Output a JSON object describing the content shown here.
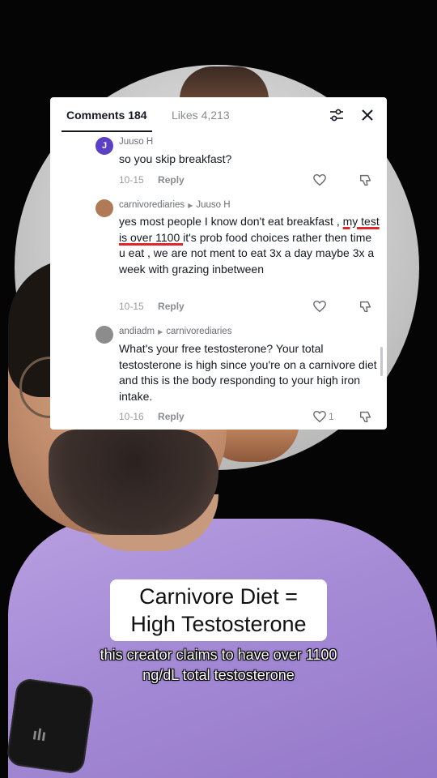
{
  "panel": {
    "tabs": [
      {
        "label": "Comments 184",
        "active": true
      },
      {
        "label": "Likes 4,213",
        "active": false
      }
    ],
    "filter_icon": "filter-sliders-icon",
    "close_icon": "close-icon"
  },
  "comments": [
    {
      "avatar_letter": "J",
      "avatar_color": "#5b3fc4",
      "author": "Juuso H",
      "reply_to": "",
      "text": "so you skip breakfast?",
      "date": "10-15",
      "reply_label": "Reply",
      "like_count": ""
    },
    {
      "avatar_letter": "",
      "avatar_color": "#b07a56",
      "author": "carnivorediaries",
      "reply_to": "Juuso H",
      "text_before": "yes most people I know don't eat breakfast , ",
      "text_underlined": "my test is over 1100 ",
      "text_after": "it's prob food choices rather then time u eat , we are not ment to eat 3x a day maybe 3x a week with grazing inbetween",
      "date": "10-15",
      "reply_label": "Reply",
      "like_count": ""
    },
    {
      "avatar_letter": "",
      "avatar_color": "#8c8c8c",
      "author": "andiadm",
      "reply_to": "carnivorediaries",
      "text": "What's your free testosterone? Your total testosterone is high since you're on a carnivore diet and this is the body responding to your high iron intake.",
      "date": "10-16",
      "reply_label": "Reply",
      "like_count": "1"
    }
  ],
  "caption": {
    "title_line1": "Carnivore Diet =",
    "title_line2": "High Testosterone",
    "subtitle": "this creator claims to have over 1100 ng/dL total testosterone"
  },
  "mic_logo": "ılı"
}
